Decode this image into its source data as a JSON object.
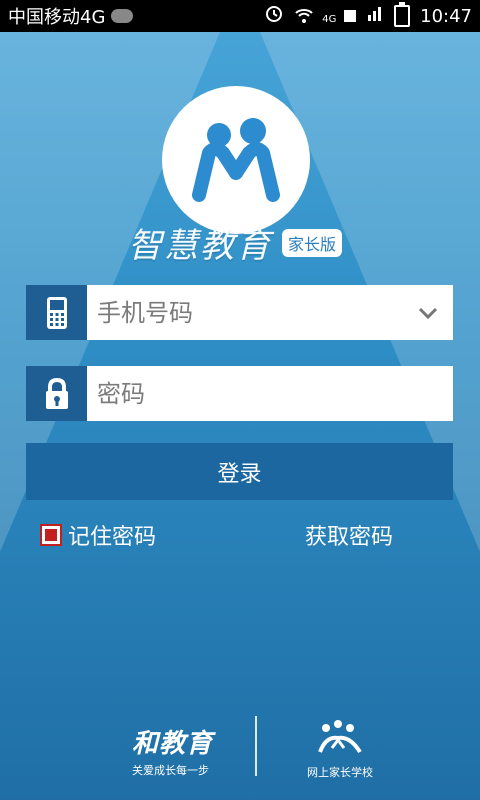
{
  "status_bar": {
    "carrier": "中国移动4G",
    "time": "10:47",
    "net_label": "4G"
  },
  "app": {
    "title": "智慧教育",
    "edition": "家长版"
  },
  "form": {
    "phone_placeholder": "手机号码",
    "password_placeholder": "密码",
    "login_label": "登录",
    "remember_label": "记住密码",
    "retrieve_label": "获取密码"
  },
  "footer": {
    "brand": "和教育",
    "slogan": "关爱成长每一步",
    "school": "网上家长学校"
  },
  "colors": {
    "accent": "#1e5e92",
    "button": "#1c679f",
    "checkbox": "#c21f1f"
  }
}
